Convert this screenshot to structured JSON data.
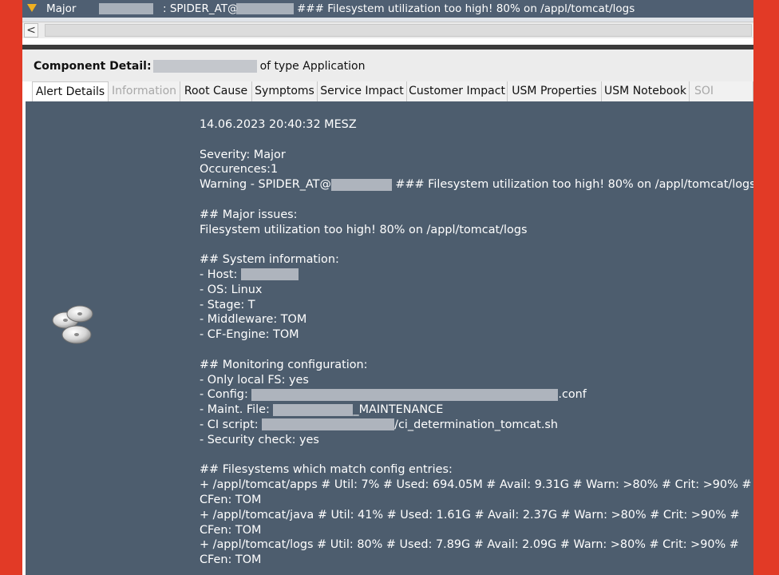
{
  "alert": {
    "severity": "Major",
    "message_prefix": ": SPIDER_AT@",
    "message_suffix": "### Filesystem utilization too high! 80% on /appl/tomcat/logs"
  },
  "scrollbar": {
    "left_arrow": "<"
  },
  "detail": {
    "label": "Component Detail:",
    "suffix": "of type Application"
  },
  "tabs": [
    {
      "label": "Alert Details",
      "state": "active"
    },
    {
      "label": "Information",
      "state": "disabled"
    },
    {
      "label": "Root Cause",
      "state": "normal"
    },
    {
      "label": "Symptoms",
      "state": "normal"
    },
    {
      "label": "Service Impact",
      "state": "normal"
    },
    {
      "label": "Customer Impact",
      "state": "normal"
    },
    {
      "label": "USM Properties",
      "state": "normal"
    },
    {
      "label": "USM Notebook",
      "state": "normal"
    },
    {
      "label": "SOI Proper",
      "state": "disabled"
    }
  ],
  "details": {
    "timestamp": "14.06.2023 20:40:32 MESZ",
    "severity": "Severity: Major",
    "occurences": "Occurences:1",
    "warning_prefix": "Warning - SPIDER_AT@",
    "warning_suffix": "### Filesystem utilization too high! 80% on /appl/tomcat/logs",
    "major_issues_heading": "## Major issues:",
    "major_issue": "Filesystem utilization too high! 80% on /appl/tomcat/logs",
    "sysinfo_heading": "## System information:",
    "host": "- Host:",
    "os": "- OS: Linux",
    "stage": "- Stage: T",
    "middleware": "- Middleware: TOM",
    "cf_engine": "- CF-Engine: TOM",
    "monitoring_heading": "## Monitoring configuration:",
    "only_local_fs": "- Only local FS: yes",
    "config_label": "- Config:",
    "config_suffix": ".conf",
    "maint_label": "- Maint. File:",
    "maint_suffix": "_MAINTENANCE",
    "ci_label": "- CI script:",
    "ci_suffix": "/ci_determination_tomcat.sh",
    "security_check": "- Security check: yes",
    "fs_heading": "## Filesystems which match config entries:",
    "fs_apps": "+ /appl/tomcat/apps # Util: 7% # Used: 694.05M # Avail: 9.31G # Warn: >80% # Crit: >90% #",
    "fs_apps_cfen": "CFen: TOM",
    "fs_java": "+ /appl/tomcat/java # Util: 41% # Used: 1.61G # Avail: 2.37G # Warn: >80% # Crit: >90% #",
    "fs_java_cfen": "CFen: TOM",
    "fs_logs": "+ /appl/tomcat/logs # Util: 80% # Used: 7.89G # Avail: 2.09G # Warn: >80% # Crit: >90% #",
    "fs_logs_cfen": "CFen: TOM"
  },
  "icons": {
    "severity": "warning-triangle-icon",
    "component": "disk-stack-icon"
  },
  "colors": {
    "outer_border": "#e23a26",
    "panel_bg": "#4d5d6e",
    "alert_row_bg": "#4f5f72",
    "severity_major": "#f0b020"
  }
}
